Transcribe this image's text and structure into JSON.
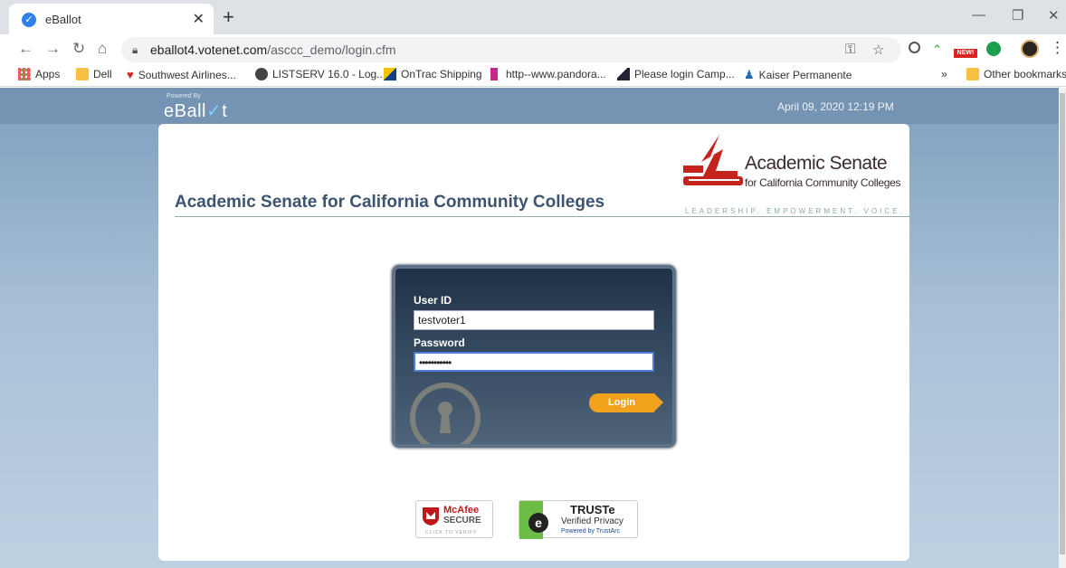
{
  "browser": {
    "tab_title": "eBallot",
    "url_host": "eballot4.votenet.com",
    "url_path": "/asccc_demo/login.cfm",
    "ext_new_badge": "NEW!",
    "bookmarks": [
      {
        "label": "Apps",
        "icon": "apps-grid-icon"
      },
      {
        "label": "Dell",
        "icon": "folder-icon"
      },
      {
        "label": "Southwest Airlines...",
        "icon": "heart-icon"
      },
      {
        "label": "LISTSERV 16.0 - Log...",
        "icon": "globe-icon"
      },
      {
        "label": "OnTrac Shipping",
        "icon": "ontrac-icon"
      },
      {
        "label": "http--www.pandora...",
        "icon": "pandora-icon"
      },
      {
        "label": "Please login  Camp...",
        "icon": "camp-icon"
      },
      {
        "label": "Kaiser Permanente",
        "icon": "kaiser-icon"
      }
    ],
    "more_bookmarks": "»",
    "other_bookmarks": "Other bookmarks"
  },
  "header": {
    "powered_by": "Powered By",
    "brand_prefix": "eBall",
    "brand_check": "✓",
    "brand_suffix": "t",
    "datetime": "April 09, 2020 12:19 PM"
  },
  "org": {
    "title": "Academic Senate for California Community Colleges",
    "logo_name": "Academic Senate",
    "logo_sub": "for California Community Colleges",
    "logo_tagline": "LEADERSHIP. EMPOWERMENT. VOICE."
  },
  "login": {
    "userid_label": "User ID",
    "userid_value": "testvoter1",
    "password_label": "Password",
    "password_value": "•••••••••••",
    "button_label": "Login"
  },
  "badges": {
    "mcafee_name": "McAfee",
    "mcafee_secure": "SECURE",
    "mcafee_click": "CLICK TO VERIFY",
    "truste_name": "TRUSTe",
    "truste_verified": "Verified Privacy",
    "truste_powered": "Powered by TrustArc"
  },
  "colors": {
    "accent_orange": "#f0a21c",
    "org_title": "#3c5470",
    "logo_red": "#c4241c"
  }
}
